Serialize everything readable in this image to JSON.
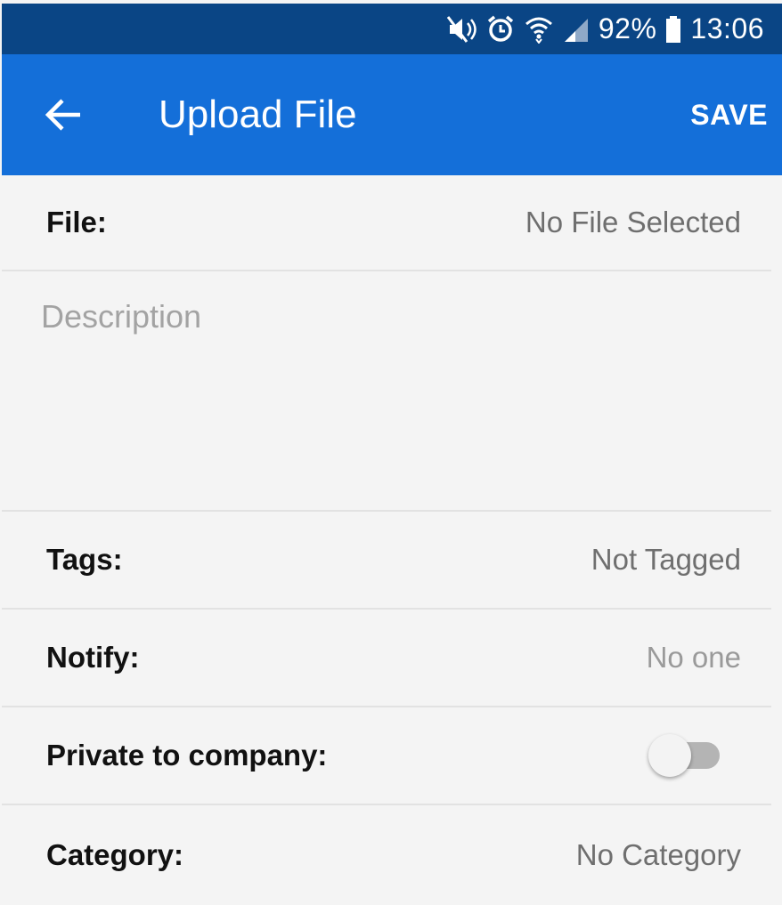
{
  "status_bar": {
    "battery_percent": "92%",
    "time": "13:06",
    "icons": [
      "mute-icon",
      "alarm-icon",
      "wifi-icon",
      "signal-icon",
      "battery-icon"
    ]
  },
  "app_bar": {
    "title": "Upload File",
    "save_label": "SAVE",
    "back_icon": "arrow-left-icon"
  },
  "form": {
    "file": {
      "label": "File:",
      "value": "No File Selected"
    },
    "description": {
      "placeholder": "Description",
      "value": ""
    },
    "tags": {
      "label": "Tags:",
      "value": "Not Tagged"
    },
    "notify": {
      "label": "Notify:",
      "value": "No one"
    },
    "private": {
      "label": "Private to company:",
      "on": false
    },
    "category": {
      "label": "Category:",
      "value": "No Category"
    }
  },
  "colors": {
    "status_bar": "#0a4585",
    "app_bar": "#146fd9",
    "background": "#f4f4f4"
  }
}
